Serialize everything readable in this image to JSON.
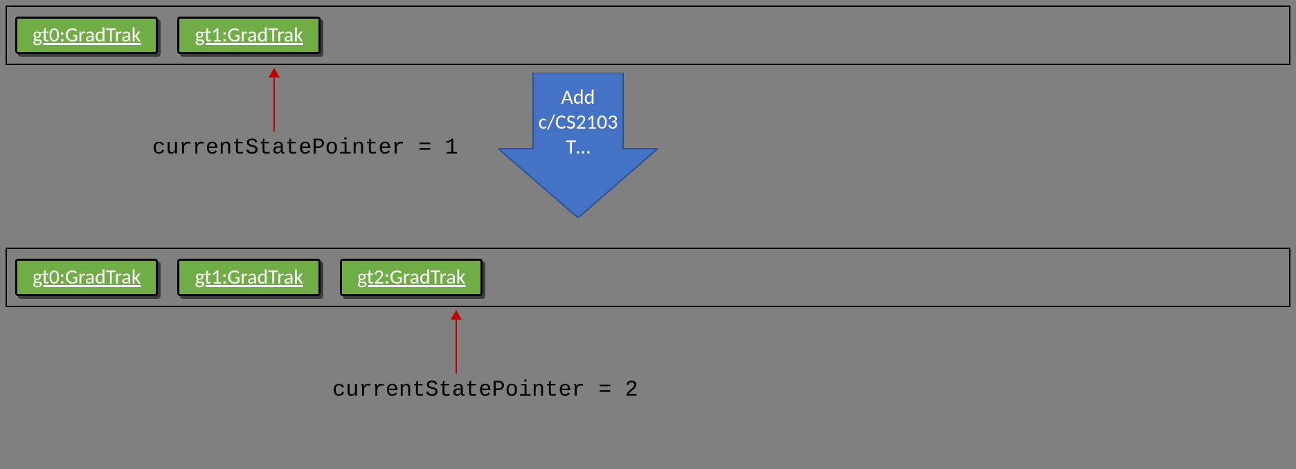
{
  "states_before": [
    {
      "label": "gt0:GradTrak"
    },
    {
      "label": "gt1:GradTrak"
    }
  ],
  "states_after": [
    {
      "label": "gt0:GradTrak"
    },
    {
      "label": "gt1:GradTrak"
    },
    {
      "label": "gt2:GradTrak"
    }
  ],
  "pointer_before": "currentStatePointer = 1",
  "pointer_after": "currentStatePointer = 2",
  "action_arrow": {
    "line1": "Add",
    "line2": "c/CS2103",
    "line3": "T…"
  }
}
